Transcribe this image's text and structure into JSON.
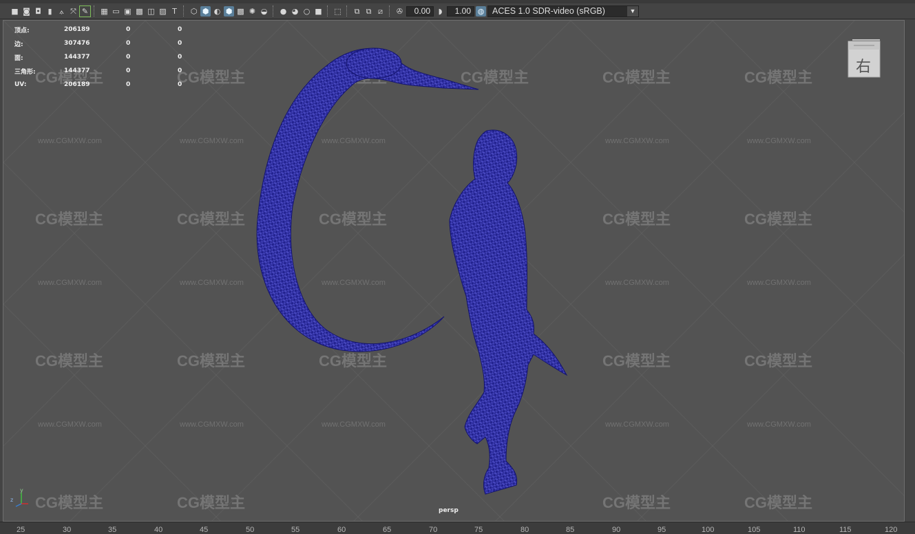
{
  "toolbar": {
    "exposure_value": "0.00",
    "gamma_value": "1.00",
    "color_management": "ACES 1.0 SDR-video (sRGB)"
  },
  "hud": {
    "rows": [
      {
        "label": "顶点:",
        "v1": "206189",
        "v2": "0",
        "v3": "0"
      },
      {
        "label": "边:",
        "v1": "307476",
        "v2": "0",
        "v3": "0"
      },
      {
        "label": "面:",
        "v1": "144377",
        "v2": "0",
        "v3": "0"
      },
      {
        "label": "三角形:",
        "v1": "144377",
        "v2": "0",
        "v3": "0"
      },
      {
        "label": "UV:",
        "v1": "206189",
        "v2": "0",
        "v3": "0"
      }
    ]
  },
  "viewcube": {
    "face_label": "右"
  },
  "camera_label": "persp",
  "axis": {
    "y": "y",
    "z": "z"
  },
  "watermark": {
    "logo": "CG模型主",
    "url": "www.CGMXW.com"
  },
  "timeline": {
    "ticks": [
      "25",
      "30",
      "35",
      "40",
      "45",
      "50",
      "55",
      "60",
      "65",
      "70",
      "75",
      "80",
      "85",
      "90",
      "95",
      "100",
      "105",
      "110",
      "115",
      "120"
    ]
  },
  "colors": {
    "wireframe": "#1a1a8c",
    "viewport_bg": "#535353"
  },
  "icons": [
    "camera-icon",
    "camera-attr-icon",
    "bookmark-icon",
    "image-plane-icon",
    "grid-icon",
    "film-gate-icon",
    "resolution-gate-icon",
    "wireframe-icon",
    "smooth-shade-icon",
    "textured-icon",
    "lights-icon",
    "shadows-icon",
    "xray-icon",
    "isolate-icon",
    "exposure-icon",
    "gamma-icon",
    "color-management-icon"
  ]
}
